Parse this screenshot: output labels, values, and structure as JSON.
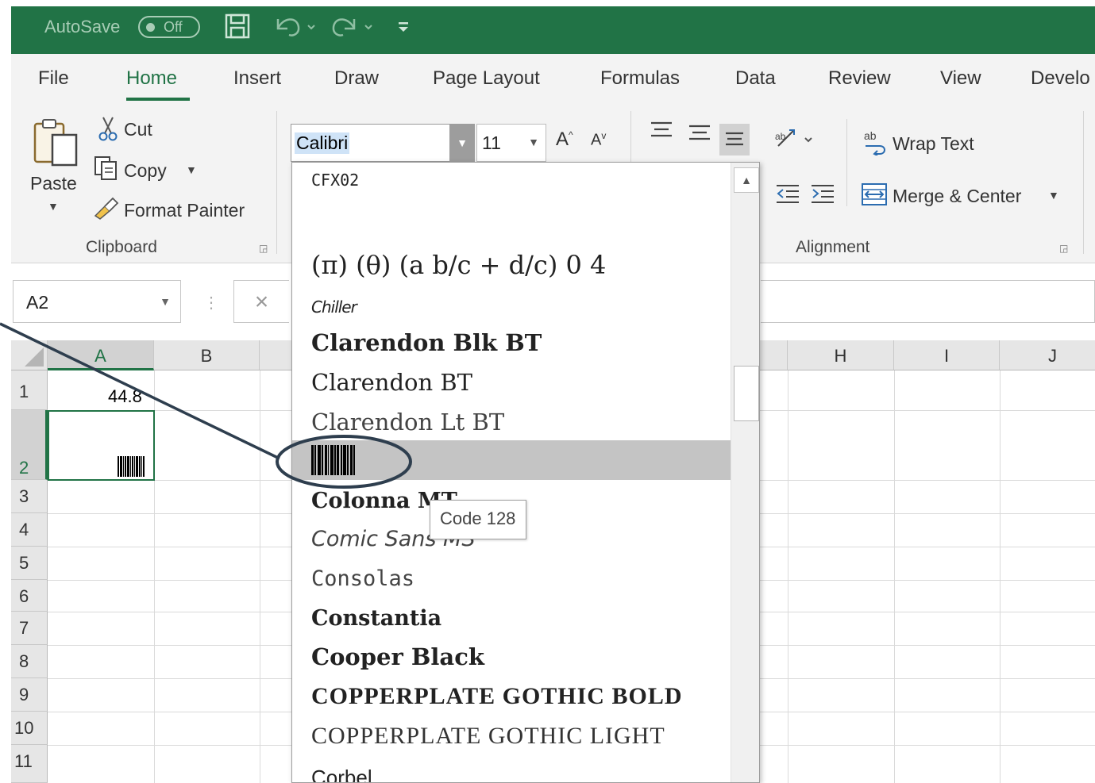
{
  "titlebar": {
    "autosave_label": "AutoSave",
    "autosave_state": "Off",
    "bg_color": "#217346"
  },
  "tabs": [
    {
      "label": "File",
      "active": false
    },
    {
      "label": "Home",
      "active": true
    },
    {
      "label": "Insert",
      "active": false
    },
    {
      "label": "Draw",
      "active": false
    },
    {
      "label": "Page Layout",
      "active": false
    },
    {
      "label": "Formulas",
      "active": false
    },
    {
      "label": "Data",
      "active": false
    },
    {
      "label": "Review",
      "active": false
    },
    {
      "label": "View",
      "active": false
    },
    {
      "label": "Develo",
      "active": false
    }
  ],
  "clipboard": {
    "paste_label": "Paste",
    "cut_label": "Cut",
    "copy_label": "Copy",
    "format_painter_label": "Format Painter",
    "group_label": "Clipboard"
  },
  "font": {
    "name": "Calibri",
    "size": "11",
    "grow_glyph": "A",
    "shrink_glyph": "A"
  },
  "alignment": {
    "wrap_text_label": "Wrap Text",
    "merge_center_label": "Merge & Center",
    "group_label": "Alignment"
  },
  "formula_bar": {
    "name_box": "A2",
    "value": ""
  },
  "grid": {
    "columns": [
      "A",
      "B",
      "H",
      "I",
      "J"
    ],
    "rows": [
      "1",
      "2",
      "3",
      "4",
      "5",
      "6",
      "7",
      "8",
      "9",
      "10",
      "11"
    ],
    "cells": {
      "A1": "44.8"
    },
    "selected_cell": "A2"
  },
  "font_list": {
    "items": [
      {
        "label": "CFX02"
      },
      {
        "label": ""
      },
      {
        "label": "(π) (θ) (a b/c + d/c) 0 4"
      },
      {
        "label": "Chiller"
      },
      {
        "label": "Clarendon Blk BT"
      },
      {
        "label": "Clarendon BT"
      },
      {
        "label": "Clarendon Lt BT"
      },
      {
        "label": "",
        "highlighted": true
      },
      {
        "label": "Colonna MT"
      },
      {
        "label": "Comic Sans MS"
      },
      {
        "label": "Consolas"
      },
      {
        "label": "Constantia"
      },
      {
        "label": "Cooper Black"
      },
      {
        "label": "COPPERPLATE GOTHIC BOLD"
      },
      {
        "label": "COPPERPLATE GOTHIC LIGHT"
      },
      {
        "label": "Corbel"
      }
    ],
    "tooltip": "Code 128"
  },
  "annotation": {
    "color": "#2e3e4e"
  }
}
